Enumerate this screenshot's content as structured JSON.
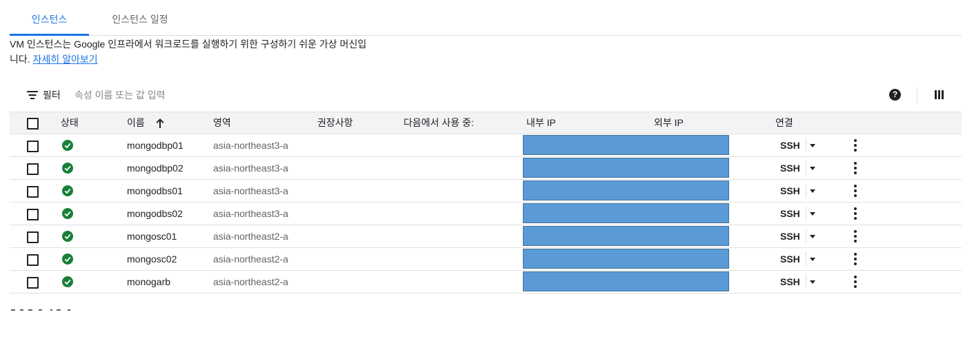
{
  "tabs": [
    {
      "label": "인스턴스"
    },
    {
      "label": "인스턴스 일정"
    }
  ],
  "description": {
    "text_line1": "VM 인스턴스는 Google 인프라에서 워크로드를 실행하기 위한 구성하기 쉬운 가상 머신입",
    "text_line2": "니다. ",
    "learn_more": "자세히 알아보기"
  },
  "filter": {
    "label": "필터",
    "placeholder": "속성 이름 또는 값 입력"
  },
  "table": {
    "headers": {
      "status": "상태",
      "name": "이름",
      "zone": "영역",
      "recommendation": "권장사항",
      "in_use_by": "다음에서 사용 중:",
      "internal_ip": "내부 IP",
      "external_ip": "외부 IP",
      "connect": "연결"
    },
    "rows": [
      {
        "name": "mongodbp01",
        "zone": "asia-northeast3-a",
        "status": "running",
        "connect": "SSH"
      },
      {
        "name": "mongodbp02",
        "zone": "asia-northeast3-a",
        "status": "running",
        "connect": "SSH"
      },
      {
        "name": "mongodbs01",
        "zone": "asia-northeast3-a",
        "status": "running",
        "connect": "SSH"
      },
      {
        "name": "mongodbs02",
        "zone": "asia-northeast3-a",
        "status": "running",
        "connect": "SSH"
      },
      {
        "name": "mongosc01",
        "zone": "asia-northeast2-a",
        "status": "running",
        "connect": "SSH"
      },
      {
        "name": "mongosc02",
        "zone": "asia-northeast2-a",
        "status": "running",
        "connect": "SSH"
      },
      {
        "name": "monogarb",
        "zone": "asia-northeast2-a",
        "status": "running",
        "connect": "SSH"
      }
    ]
  },
  "colors": {
    "accent": "#1a73e8",
    "status_ok": "#188038",
    "ip_redaction": "#5b9bd5",
    "header_bg": "#f1f3f4"
  },
  "icons": {
    "filter": "filter-icon",
    "sort": "arrow-up-icon",
    "status": "check-circle-icon",
    "help": "help-icon",
    "columns": "columns-icon",
    "more": "more-vert-icon",
    "dropdown": "caret-down-icon"
  }
}
